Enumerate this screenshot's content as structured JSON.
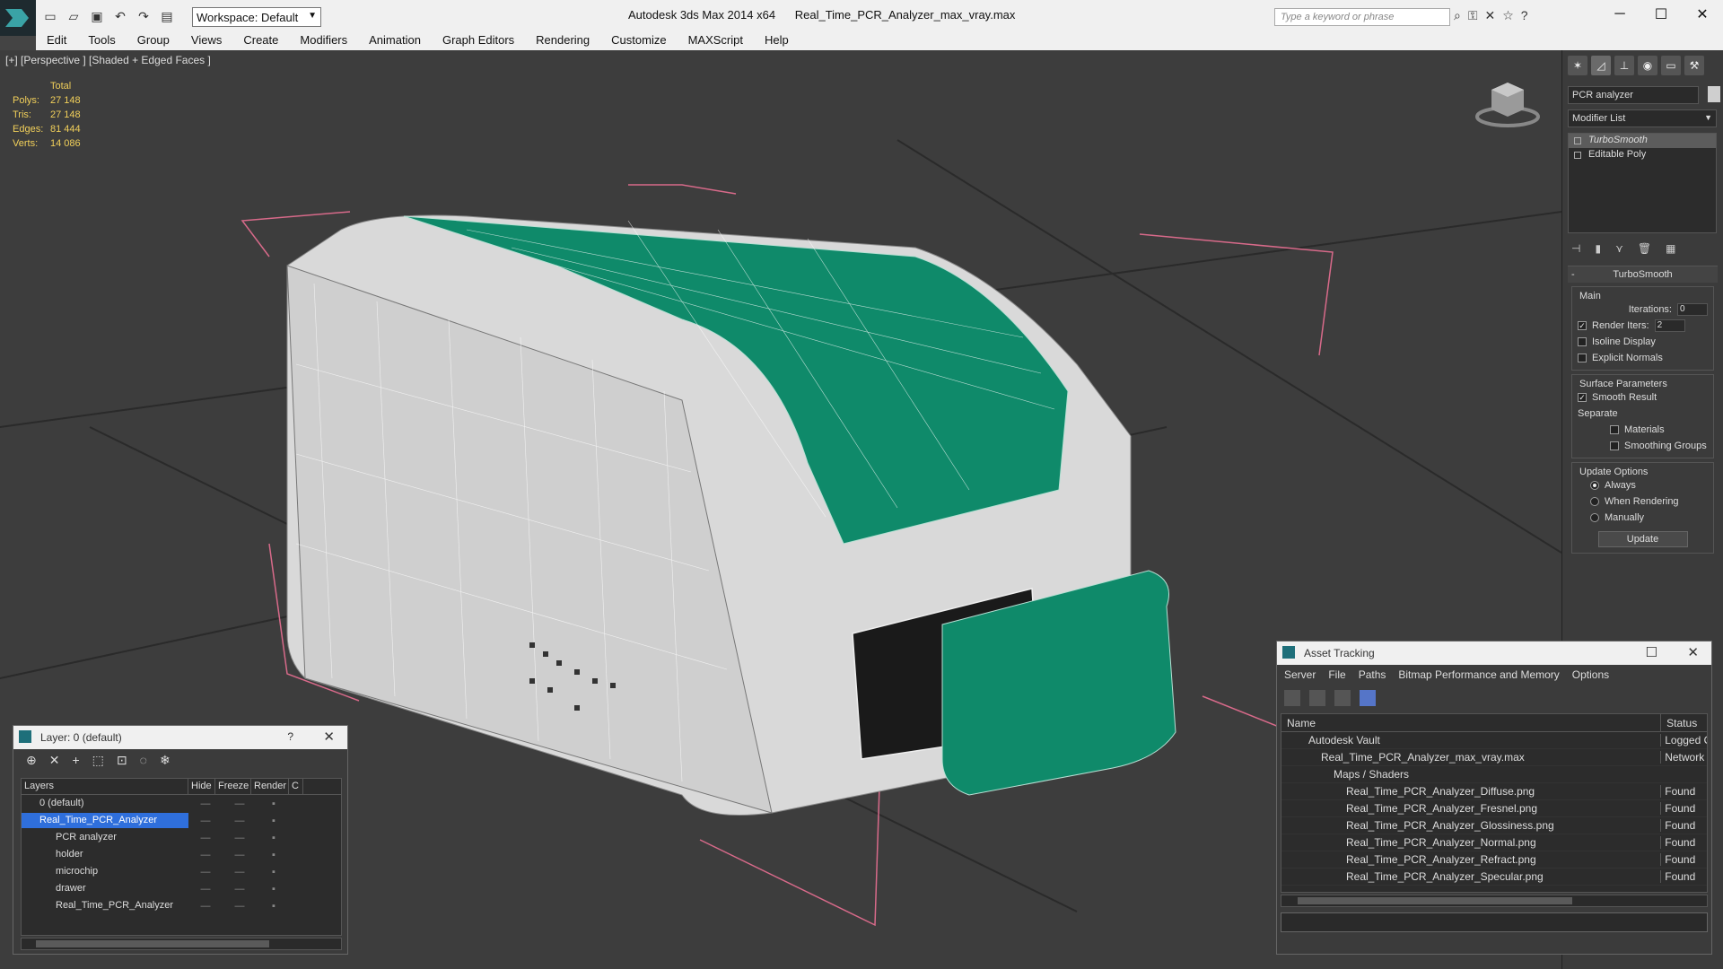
{
  "titlebar": {
    "workspace": "Workspace: Default",
    "app": "Autodesk 3ds Max  2014 x64",
    "file": "Real_Time_PCR_Analyzer_max_vray.max",
    "search_placeholder": "Type a keyword or phrase"
  },
  "menu": [
    "Edit",
    "Tools",
    "Group",
    "Views",
    "Create",
    "Modifiers",
    "Animation",
    "Graph Editors",
    "Rendering",
    "Customize",
    "MAXScript",
    "Help"
  ],
  "viewport": {
    "label": "[+] [Perspective ] [Shaded + Edged Faces ]",
    "stats": {
      "total_label": "Total",
      "rows": [
        {
          "k": "Polys:",
          "v": "27 148"
        },
        {
          "k": "Tris:",
          "v": "27 148"
        },
        {
          "k": "Edges:",
          "v": "81 444"
        },
        {
          "k": "Verts:",
          "v": "14 086"
        }
      ]
    }
  },
  "command_panel": {
    "object_name": "PCR analyzer",
    "modifier_list": "Modifier List",
    "stack": [
      "TurboSmooth",
      "Editable Poly"
    ],
    "rollout_title": "TurboSmooth",
    "main_label": "Main",
    "iterations_label": "Iterations:",
    "iterations_value": "0",
    "render_iters_label": "Render Iters:",
    "render_iters_value": "2",
    "isoline": "Isoline Display",
    "explicit_normals": "Explicit Normals",
    "surface_params": "Surface Parameters",
    "smooth_result": "Smooth Result",
    "separate": "Separate",
    "materials": "Materials",
    "smoothing_groups": "Smoothing Groups",
    "update_options": "Update Options",
    "always": "Always",
    "when_rendering": "When Rendering",
    "manually": "Manually",
    "update_btn": "Update"
  },
  "layers": {
    "title": "Layer: 0 (default)",
    "help": "?",
    "columns": [
      "Layers",
      "Hide",
      "Freeze",
      "Render",
      "C"
    ],
    "rows": [
      {
        "name": "0 (default)",
        "selected": false
      },
      {
        "name": "Real_Time_PCR_Analyzer",
        "selected": true
      },
      {
        "name": "PCR analyzer",
        "selected": false
      },
      {
        "name": "holder",
        "selected": false
      },
      {
        "name": "microchip",
        "selected": false
      },
      {
        "name": "drawer",
        "selected": false
      },
      {
        "name": "Real_Time_PCR_Analyzer",
        "selected": false
      }
    ]
  },
  "asset": {
    "title": "Asset Tracking",
    "menu": [
      "Server",
      "File",
      "Paths",
      "Bitmap Performance and Memory",
      "Options"
    ],
    "columns": [
      "Name",
      "Status"
    ],
    "rows": [
      {
        "name": "Autodesk Vault",
        "status": "Logged O"
      },
      {
        "name": "Real_Time_PCR_Analyzer_max_vray.max",
        "status": "Network"
      },
      {
        "name": "Maps / Shaders",
        "status": ""
      },
      {
        "name": "Real_Time_PCR_Analyzer_Diffuse.png",
        "status": "Found"
      },
      {
        "name": "Real_Time_PCR_Analyzer_Fresnel.png",
        "status": "Found"
      },
      {
        "name": "Real_Time_PCR_Analyzer_Glossiness.png",
        "status": "Found"
      },
      {
        "name": "Real_Time_PCR_Analyzer_Normal.png",
        "status": "Found"
      },
      {
        "name": "Real_Time_PCR_Analyzer_Refract.png",
        "status": "Found"
      },
      {
        "name": "Real_Time_PCR_Analyzer_Specular.png",
        "status": "Found"
      }
    ]
  },
  "colors": {
    "accent_green": "#0f8a6a",
    "selection_blue": "#2f6fdc",
    "stats_yellow": "#f2d05a"
  }
}
